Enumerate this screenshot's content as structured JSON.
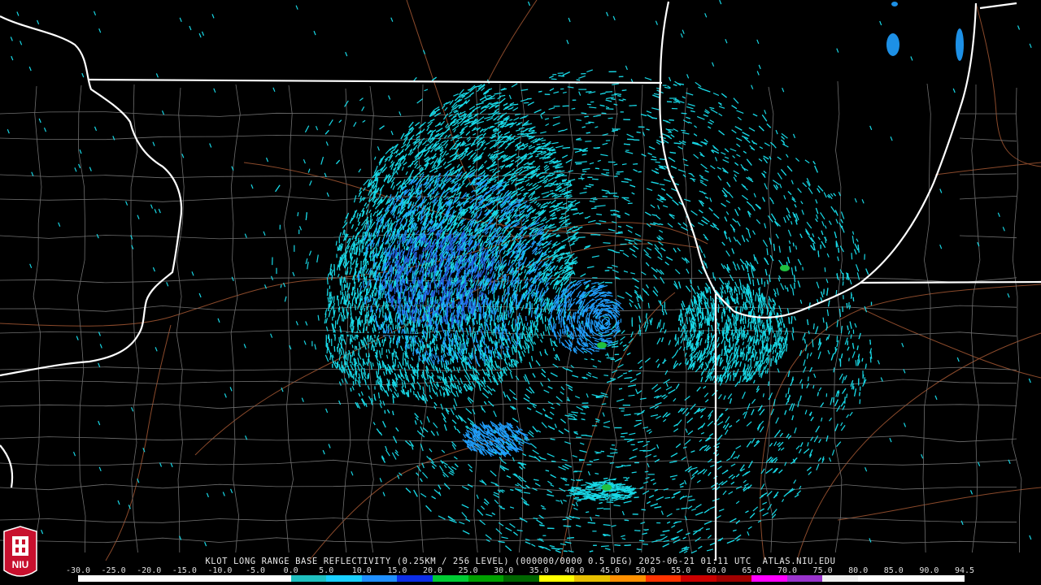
{
  "product": {
    "site": "KLOT",
    "title_line": "KLOT LONG RANGE BASE REFLECTIVITY (0.25KM / 256 LEVEL) (000000/0000 0.5 DEG)",
    "timestamp": "2025-06-21 01:11 UTC",
    "credit": "ATLAS.NIU.EDU"
  },
  "logo": {
    "text": "NIU",
    "colors": {
      "shield": "#c8102e",
      "mark": "#ffffff"
    }
  },
  "color_scale": {
    "ticks": [
      "-30.0",
      "-25.0",
      "-20.0",
      "-15.0",
      "-10.0",
      "-5.0",
      "0.0",
      "5.0",
      "10.0",
      "15.0",
      "20.0",
      "25.0",
      "30.0",
      "35.0",
      "40.0",
      "45.0",
      "50.0",
      "55.0",
      "60.0",
      "65.0",
      "70.0",
      "75.0",
      "80.0",
      "85.0",
      "90.0",
      "94.5"
    ],
    "colors": [
      "#ffffff",
      "#ffffff",
      "#ffffff",
      "#ffffff",
      "#ffffff",
      "#ffffff",
      "#20c0c0",
      "#19cfff",
      "#1f8fff",
      "#0c2ee8",
      "#00cc33",
      "#00a000",
      "#006600",
      "#ffff00",
      "#e8c000",
      "#ff9000",
      "#ff3300",
      "#cc0000",
      "#a00000",
      "#ff00ff",
      "#9933cc",
      "#f0f0f0",
      "#ffffff",
      "#ffffff",
      "#ffffff"
    ]
  },
  "map_style": {
    "background": "#000000",
    "state_border": "#ffffff",
    "county_line": "#6f6f6f",
    "road_line": "#8b4a2b",
    "echo_light": "#18d8e6",
    "echo_mid": "#20a0ff",
    "echo_dark": "#2460e0",
    "echo_green": "#20c040"
  }
}
